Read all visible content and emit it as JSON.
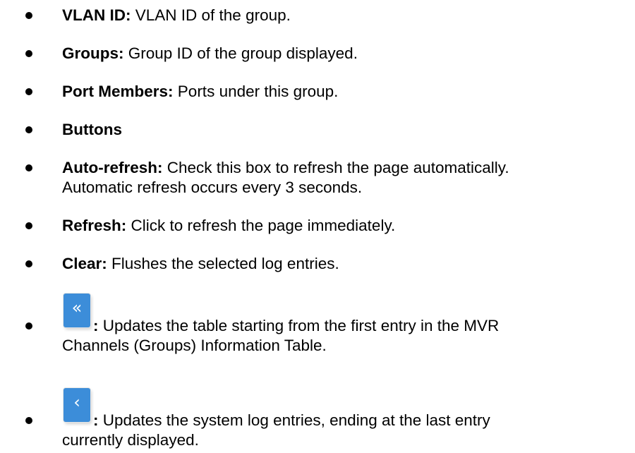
{
  "items": [
    {
      "term": "VLAN ID:",
      "desc": " VLAN ID of the group."
    },
    {
      "term": "Groups:",
      "desc": " Group ID of the group displayed."
    },
    {
      "term": "Port Members:",
      "desc": " Ports under this group."
    },
    {
      "term": "Buttons",
      "desc": ""
    },
    {
      "term": "Auto-refresh:",
      "desc": " Check this box to refresh the page automatically.",
      "desc2": "Automatic refresh occurs every 3 seconds."
    },
    {
      "term": "Refresh:",
      "desc": " Click to refresh the page immediately."
    },
    {
      "term": "Clear:",
      "desc": " Flushes the selected log entries."
    },
    {
      "term": ":",
      "desc": " Updates the table starting from the first entry in the MVR",
      "desc2": "Channels (Groups) Information Table.",
      "icon": "«",
      "icon_name": "first-page-icon"
    },
    {
      "term": ":",
      "desc": " Updates the system log entries, ending at the last entry",
      "desc2": "currently displayed.",
      "icon": "‹",
      "icon_name": "previous-page-icon"
    }
  ],
  "colors": {
    "button_blue": "#3c8dd9",
    "text": "#000000"
  }
}
